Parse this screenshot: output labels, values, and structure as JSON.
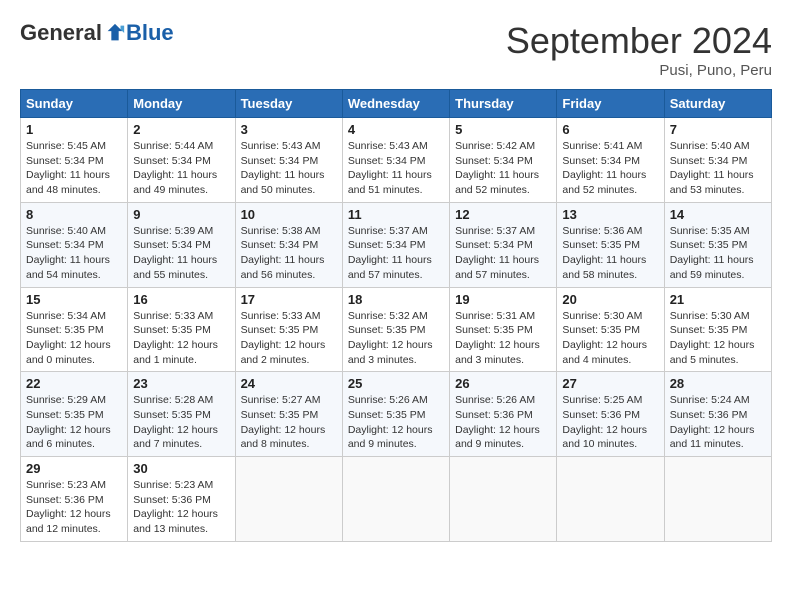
{
  "header": {
    "logo_general": "General",
    "logo_blue": "Blue",
    "month_title": "September 2024",
    "location": "Pusi, Puno, Peru"
  },
  "calendar": {
    "weekdays": [
      "Sunday",
      "Monday",
      "Tuesday",
      "Wednesday",
      "Thursday",
      "Friday",
      "Saturday"
    ],
    "weeks": [
      [
        {
          "day": "1",
          "sunrise": "5:45 AM",
          "sunset": "5:34 PM",
          "daylight": "11 hours and 48 minutes."
        },
        {
          "day": "2",
          "sunrise": "5:44 AM",
          "sunset": "5:34 PM",
          "daylight": "11 hours and 49 minutes."
        },
        {
          "day": "3",
          "sunrise": "5:43 AM",
          "sunset": "5:34 PM",
          "daylight": "11 hours and 50 minutes."
        },
        {
          "day": "4",
          "sunrise": "5:43 AM",
          "sunset": "5:34 PM",
          "daylight": "11 hours and 51 minutes."
        },
        {
          "day": "5",
          "sunrise": "5:42 AM",
          "sunset": "5:34 PM",
          "daylight": "11 hours and 52 minutes."
        },
        {
          "day": "6",
          "sunrise": "5:41 AM",
          "sunset": "5:34 PM",
          "daylight": "11 hours and 52 minutes."
        },
        {
          "day": "7",
          "sunrise": "5:40 AM",
          "sunset": "5:34 PM",
          "daylight": "11 hours and 53 minutes."
        }
      ],
      [
        {
          "day": "8",
          "sunrise": "5:40 AM",
          "sunset": "5:34 PM",
          "daylight": "11 hours and 54 minutes."
        },
        {
          "day": "9",
          "sunrise": "5:39 AM",
          "sunset": "5:34 PM",
          "daylight": "11 hours and 55 minutes."
        },
        {
          "day": "10",
          "sunrise": "5:38 AM",
          "sunset": "5:34 PM",
          "daylight": "11 hours and 56 minutes."
        },
        {
          "day": "11",
          "sunrise": "5:37 AM",
          "sunset": "5:34 PM",
          "daylight": "11 hours and 57 minutes."
        },
        {
          "day": "12",
          "sunrise": "5:37 AM",
          "sunset": "5:34 PM",
          "daylight": "11 hours and 57 minutes."
        },
        {
          "day": "13",
          "sunrise": "5:36 AM",
          "sunset": "5:35 PM",
          "daylight": "11 hours and 58 minutes."
        },
        {
          "day": "14",
          "sunrise": "5:35 AM",
          "sunset": "5:35 PM",
          "daylight": "11 hours and 59 minutes."
        }
      ],
      [
        {
          "day": "15",
          "sunrise": "5:34 AM",
          "sunset": "5:35 PM",
          "daylight": "12 hours and 0 minutes."
        },
        {
          "day": "16",
          "sunrise": "5:33 AM",
          "sunset": "5:35 PM",
          "daylight": "12 hours and 1 minute."
        },
        {
          "day": "17",
          "sunrise": "5:33 AM",
          "sunset": "5:35 PM",
          "daylight": "12 hours and 2 minutes."
        },
        {
          "day": "18",
          "sunrise": "5:32 AM",
          "sunset": "5:35 PM",
          "daylight": "12 hours and 3 minutes."
        },
        {
          "day": "19",
          "sunrise": "5:31 AM",
          "sunset": "5:35 PM",
          "daylight": "12 hours and 3 minutes."
        },
        {
          "day": "20",
          "sunrise": "5:30 AM",
          "sunset": "5:35 PM",
          "daylight": "12 hours and 4 minutes."
        },
        {
          "day": "21",
          "sunrise": "5:30 AM",
          "sunset": "5:35 PM",
          "daylight": "12 hours and 5 minutes."
        }
      ],
      [
        {
          "day": "22",
          "sunrise": "5:29 AM",
          "sunset": "5:35 PM",
          "daylight": "12 hours and 6 minutes."
        },
        {
          "day": "23",
          "sunrise": "5:28 AM",
          "sunset": "5:35 PM",
          "daylight": "12 hours and 7 minutes."
        },
        {
          "day": "24",
          "sunrise": "5:27 AM",
          "sunset": "5:35 PM",
          "daylight": "12 hours and 8 minutes."
        },
        {
          "day": "25",
          "sunrise": "5:26 AM",
          "sunset": "5:35 PM",
          "daylight": "12 hours and 9 minutes."
        },
        {
          "day": "26",
          "sunrise": "5:26 AM",
          "sunset": "5:36 PM",
          "daylight": "12 hours and 9 minutes."
        },
        {
          "day": "27",
          "sunrise": "5:25 AM",
          "sunset": "5:36 PM",
          "daylight": "12 hours and 10 minutes."
        },
        {
          "day": "28",
          "sunrise": "5:24 AM",
          "sunset": "5:36 PM",
          "daylight": "12 hours and 11 minutes."
        }
      ],
      [
        {
          "day": "29",
          "sunrise": "5:23 AM",
          "sunset": "5:36 PM",
          "daylight": "12 hours and 12 minutes."
        },
        {
          "day": "30",
          "sunrise": "5:23 AM",
          "sunset": "5:36 PM",
          "daylight": "12 hours and 13 minutes."
        },
        null,
        null,
        null,
        null,
        null
      ]
    ]
  }
}
